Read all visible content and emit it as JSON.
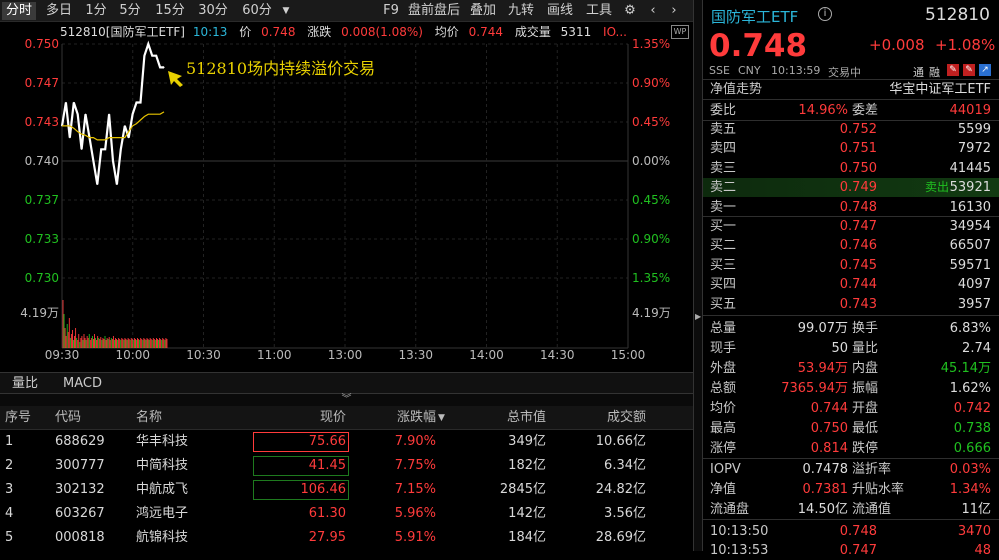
{
  "toolbar": {
    "left_tabs": [
      "分时",
      "多日",
      "1分",
      "5分",
      "15分",
      "30分",
      "60分"
    ],
    "right_items": [
      "F9",
      "盘前盘后",
      "叠加",
      "九转",
      "画线",
      "工具"
    ]
  },
  "quote": {
    "code_name": "512810[国防军工ETF]",
    "time": "10:13",
    "price_label": "价",
    "price": "0.748",
    "chg_label": "涨跌",
    "chg": "0.008(1.08%)",
    "avg_label": "均价",
    "avg": "0.744",
    "vol_label": "成交量",
    "vol": "5311",
    "iopv_label": "IO..."
  },
  "chart_data": {
    "type": "line",
    "title": "",
    "annotation": "512810场内持续溢价交易",
    "y_left_ticks": [
      "0.750",
      "0.747",
      "0.743",
      "0.740",
      "0.737",
      "0.733",
      "0.730"
    ],
    "y_right_ticks": [
      "1.35%",
      "0.90%",
      "0.45%",
      "0.00%",
      "0.45%",
      "0.90%",
      "1.35%"
    ],
    "vol_tick_left": "4.19万",
    "vol_tick_right": "4.19万",
    "x_ticks": [
      "09:30",
      "10:00",
      "10:30",
      "11:00",
      "13:00",
      "13:30",
      "14:00",
      "14:30",
      "15:00"
    ],
    "ylim": [
      0.73,
      0.75
    ],
    "prev_close": 0.74,
    "series": [
      {
        "values": [
          0.743,
          0.745,
          0.742,
          0.745,
          0.744,
          0.741,
          0.744,
          0.742,
          0.74,
          0.738,
          0.741,
          0.741,
          0.744,
          0.74,
          0.738,
          0.741,
          0.743,
          0.742,
          0.744,
          0.745,
          0.745,
          0.749,
          0.75,
          0.749,
          0.749,
          0.748,
          0.748
        ]
      },
      {
        "values": [
          0.743,
          0.743,
          0.743,
          0.7428,
          0.7425,
          0.7423,
          0.7422,
          0.742,
          0.742,
          0.7418,
          0.7418,
          0.7418,
          0.742,
          0.742,
          0.742,
          0.742,
          0.742,
          0.7425,
          0.743,
          0.7432,
          0.7435,
          0.7438,
          0.744,
          0.744,
          0.744,
          0.744,
          0.7442
        ]
      }
    ]
  },
  "bottom_tabs": [
    "量比",
    "MACD"
  ],
  "table": {
    "headers": [
      "序号",
      "代码",
      "名称",
      "现价",
      "涨跌幅",
      "总市值",
      "成交额"
    ],
    "rows": [
      [
        "1",
        "688629",
        "华丰科技",
        "75.66",
        "7.90%",
        "349亿",
        "10.66亿"
      ],
      [
        "2",
        "300777",
        "中简科技",
        "41.45",
        "7.75%",
        "182亿",
        "6.34亿"
      ],
      [
        "3",
        "302132",
        "中航成飞",
        "106.46",
        "7.15%",
        "2845亿",
        "24.82亿"
      ],
      [
        "4",
        "603267",
        "鸿远电子",
        "61.30",
        "5.96%",
        "142亿",
        "3.56亿"
      ],
      [
        "5",
        "000818",
        "航锦科技",
        "27.95",
        "5.91%",
        "184亿",
        "28.69亿"
      ]
    ]
  },
  "panel": {
    "name": "国防军工ETF",
    "code": "512810",
    "price": "0.748",
    "chg": "+0.008",
    "pct": "+1.08%",
    "exch": "SSE",
    "currency": "CNY",
    "clock": "10:13:59",
    "status": "交易中",
    "tags": [
      "通",
      "融"
    ],
    "net_label": "净值走势",
    "tracker": "华宝中证军工ETF",
    "weibi_label": "委比",
    "weibi": "14.96%",
    "weicha_label": "委差",
    "weicha": "44019",
    "asks": [
      {
        "label": "卖五",
        "price": "0.752",
        "vol": "5599"
      },
      {
        "label": "卖四",
        "price": "0.751",
        "vol": "7972"
      },
      {
        "label": "卖三",
        "price": "0.750",
        "vol": "41445"
      },
      {
        "label": "卖二",
        "price": "0.749",
        "vol": "53921",
        "tag": "卖出"
      },
      {
        "label": "卖一",
        "price": "0.748",
        "vol": "16130"
      }
    ],
    "bids": [
      {
        "label": "买一",
        "price": "0.747",
        "vol": "34954"
      },
      {
        "label": "买二",
        "price": "0.746",
        "vol": "66507"
      },
      {
        "label": "买三",
        "price": "0.745",
        "vol": "59571"
      },
      {
        "label": "买四",
        "price": "0.744",
        "vol": "4097"
      },
      {
        "label": "买五",
        "price": "0.743",
        "vol": "3957"
      }
    ],
    "stats": [
      [
        "总量",
        "99.07万",
        "换手",
        "6.83%"
      ],
      [
        "现手",
        "50",
        "量比",
        "2.74"
      ],
      [
        "外盘",
        "53.94万",
        "内盘",
        "45.14万"
      ],
      [
        "总额",
        "7365.94万",
        "振幅",
        "1.62%"
      ],
      [
        "均价",
        "0.744",
        "开盘",
        "0.742"
      ],
      [
        "最高",
        "0.750",
        "最低",
        "0.738"
      ],
      [
        "涨停",
        "0.814",
        "跌停",
        "0.666"
      ]
    ],
    "extra": [
      [
        "IOPV",
        "0.7478",
        "溢折率",
        "0.03%"
      ],
      [
        "净值",
        "0.7381",
        "升贴水率",
        "1.34%"
      ],
      [
        "流通盘",
        "14.50亿",
        "流通值",
        "11亿"
      ]
    ],
    "ticks": [
      {
        "time": "10:13:50",
        "price": "0.748",
        "vol": "3470"
      },
      {
        "time": "10:13:53",
        "price": "0.747",
        "vol": "48"
      }
    ]
  }
}
